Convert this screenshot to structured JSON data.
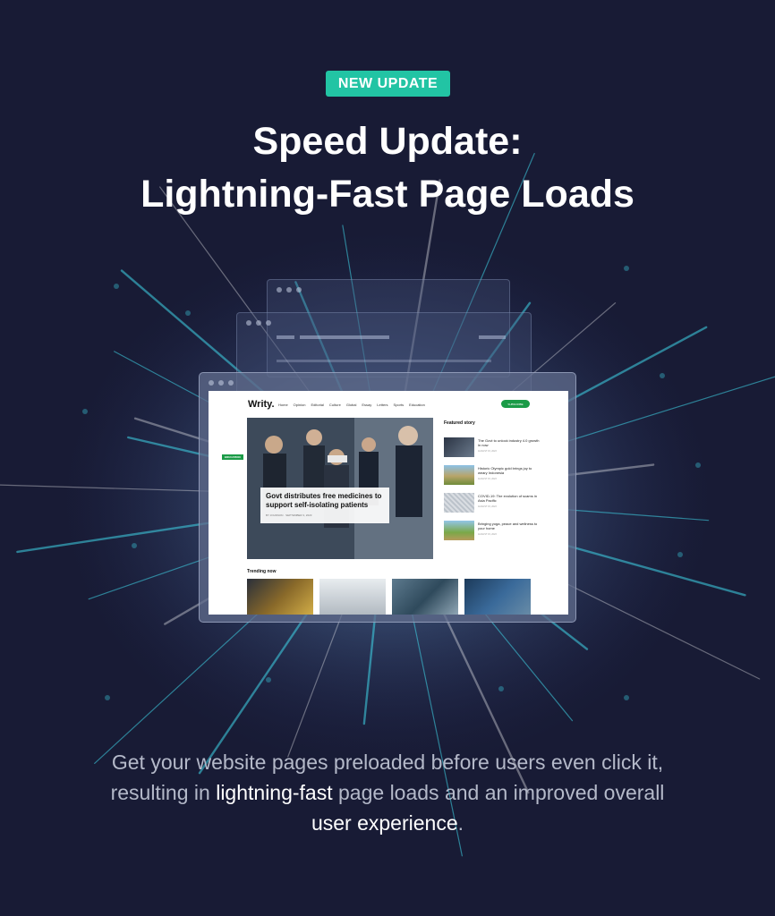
{
  "badge": "NEW UPDATE",
  "headline": {
    "line1": "Speed Update:",
    "line2": "Lightning-Fast Page Loads"
  },
  "mockup": {
    "logo": "Writy.",
    "nav": [
      "Home",
      "Opinion",
      "Editorial",
      "Culture",
      "Global",
      "Essay",
      "Letters",
      "Sports",
      "Education"
    ],
    "subscribe": "SUBSCRIBE",
    "hero": {
      "tag": "EDUCATION",
      "title": "Govt distributes free medicines to support self-isolating patients",
      "meta": "BY JOHNSON · SEPTEMBER 3, 2023"
    },
    "featured_label": "Featured story",
    "featured": [
      {
        "title": "The Govt to unlock industry 4.0 growth in now",
        "date": "AUGUST 15, 2023"
      },
      {
        "title": "Historic Olympic gold brings joy to weary Indonesia",
        "date": "AUGUST 15, 2023"
      },
      {
        "title": "COVID-19: The evolution of scams in Asia Pacific",
        "date": "AUGUST 15, 2023"
      },
      {
        "title": "Bringing yoga, peace and wellness to your home",
        "date": "AUGUST 15, 2023"
      }
    ],
    "trending_label": "Trending now"
  },
  "caption": {
    "part1": "Get your website pages preloaded before users even click it, resulting in ",
    "hl1": "lightning-fast",
    "part2": " page loads and an improved overall ",
    "hl2": "user experience",
    "part3": "."
  },
  "colors": {
    "background": "#181b35",
    "badge": "#22c4a4",
    "highlight_text": "#ffffff",
    "body_text": "#b4b9c9",
    "ray": "#3fd6e8"
  }
}
